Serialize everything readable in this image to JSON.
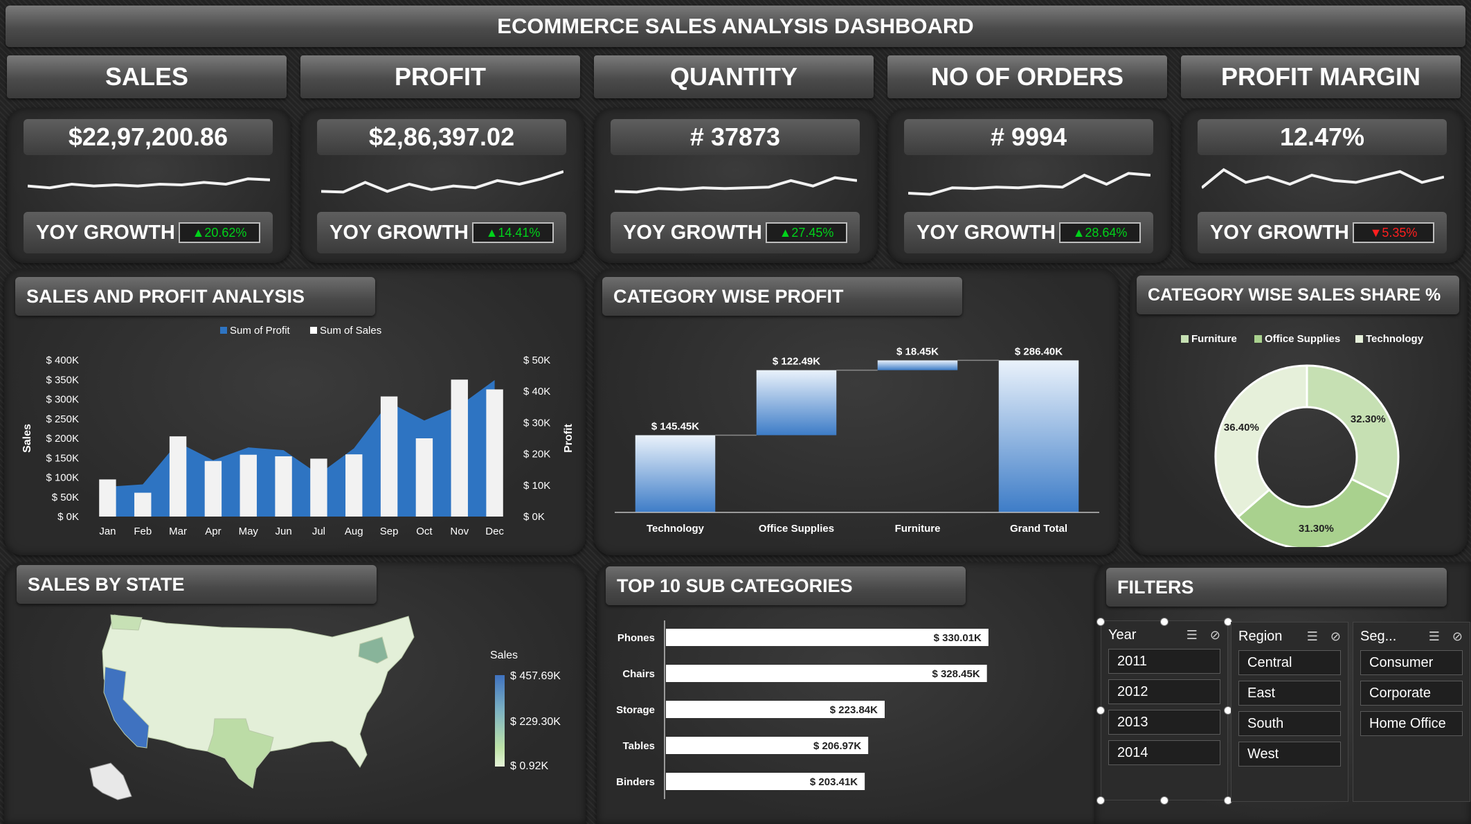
{
  "title": "ECOMMERCE SALES ANALYSIS DASHBOARD",
  "kpis": [
    {
      "label": "SALES",
      "value": "$22,97,200.86",
      "yoy_label": "YOY GROWTH",
      "growth": "▲20.62%",
      "direction": "up",
      "trend": [
        0.55,
        0.6,
        0.5,
        0.55,
        0.52,
        0.55,
        0.5,
        0.52,
        0.45,
        0.5,
        0.35,
        0.38
      ]
    },
    {
      "label": "PROFIT",
      "value": "$2,86,397.02",
      "yoy_label": "YOY GROWTH",
      "growth": "▲14.41%",
      "direction": "up",
      "trend": [
        0.7,
        0.72,
        0.45,
        0.7,
        0.5,
        0.65,
        0.55,
        0.6,
        0.4,
        0.5,
        0.35,
        0.15
      ]
    },
    {
      "label": "QUANTITY",
      "value": "# 37873",
      "yoy_label": "YOY GROWTH",
      "growth": "▲27.45%",
      "direction": "up",
      "trend": [
        0.7,
        0.72,
        0.62,
        0.65,
        0.6,
        0.62,
        0.6,
        0.58,
        0.4,
        0.55,
        0.32,
        0.4
      ]
    },
    {
      "label": "NO OF ORDERS",
      "value": "# 9994",
      "yoy_label": "YOY GROWTH",
      "growth": "▲28.64%",
      "direction": "up",
      "trend": [
        0.75,
        0.78,
        0.6,
        0.62,
        0.58,
        0.6,
        0.55,
        0.58,
        0.25,
        0.5,
        0.2,
        0.25
      ]
    },
    {
      "label": "PROFIT MARGIN",
      "value": "12.47%",
      "yoy_label": "YOY GROWTH",
      "growth": "▼5.35%",
      "direction": "down",
      "trend": [
        0.6,
        0.1,
        0.45,
        0.3,
        0.5,
        0.25,
        0.4,
        0.45,
        0.3,
        0.15,
        0.45,
        0.3
      ]
    }
  ],
  "sections": {
    "sales_profit": "SALES AND PROFIT ANALYSIS",
    "category_profit": "CATEGORY WISE PROFIT",
    "category_share": "CATEGORY WISE SALES SHARE %",
    "sales_by_state": "SALES BY STATE",
    "top10": "TOP 10 SUB CATEGORIES",
    "filters": "FILTERS"
  },
  "colors": {
    "blue": "#2e74c2",
    "white_bar": "#f2f2f2",
    "donut_light": "#e6f0da",
    "donut_mid": "#c6e0b3",
    "donut_dark": "#a9d18e"
  },
  "chart_data": [
    {
      "type": "bar",
      "title": "SALES AND PROFIT ANALYSIS",
      "categories": [
        "Jan",
        "Feb",
        "Mar",
        "Apr",
        "May",
        "Jun",
        "Jul",
        "Aug",
        "Sep",
        "Oct",
        "Nov",
        "Dec"
      ],
      "series": [
        {
          "name": "Sum of Profit",
          "type": "area",
          "axis": "right",
          "values": [
            9500,
            10300,
            23700,
            18000,
            22100,
            21200,
            13500,
            21800,
            36500,
            30700,
            35400,
            43600
          ]
        },
        {
          "name": "Sum of Sales",
          "type": "bar",
          "axis": "left",
          "values": [
            94900,
            60900,
            205000,
            142000,
            158000,
            154000,
            148000,
            159000,
            307000,
            200000,
            350000,
            325000
          ]
        }
      ],
      "ylabel": "Sales",
      "y2label": "Profit",
      "yticks": [
        "$ 0K",
        "$ 50K",
        "$ 100K",
        "$ 150K",
        "$ 200K",
        "$ 250K",
        "$ 300K",
        "$ 350K",
        "$ 400K"
      ],
      "y2ticks": [
        "$ 0K",
        "$ 10K",
        "$ 20K",
        "$ 30K",
        "$ 40K",
        "$ 50K"
      ],
      "ylim": [
        0,
        400000
      ],
      "y2lim": [
        0,
        50000
      ],
      "legend": "top"
    },
    {
      "type": "bar",
      "subtype": "waterfall",
      "title": "CATEGORY WISE PROFIT",
      "categories": [
        "Technology",
        "Office Supplies",
        "Furniture",
        "Grand Total"
      ],
      "values": [
        145.45,
        122.49,
        18.45,
        286.4
      ],
      "labels": [
        "$ 145.45K",
        "$ 122.49K",
        "$ 18.45K",
        "$ 286.40K"
      ],
      "ylim": [
        0,
        300
      ]
    },
    {
      "type": "pie",
      "subtype": "donut",
      "title": "CATEGORY WISE SALES SHARE %",
      "categories": [
        "Furniture",
        "Office Supplies",
        "Technology"
      ],
      "values": [
        32.3,
        31.3,
        36.4
      ],
      "labels": [
        "32.30%",
        "31.30%",
        "36.40%"
      ],
      "legend": "top"
    },
    {
      "type": "bar",
      "subtype": "horizontal",
      "title": "TOP 10 SUB CATEGORIES",
      "categories": [
        "Phones",
        "Chairs",
        "Storage",
        "Tables",
        "Binders"
      ],
      "values": [
        330.01,
        328.45,
        223.84,
        206.97,
        203.41
      ],
      "labels": [
        "$ 330.01K",
        "$ 328.45K",
        "$ 223.84K",
        "$ 206.97K",
        "$ 203.41K"
      ]
    }
  ],
  "map": {
    "legend_title": "Sales",
    "legend_max": "$ 457.69K",
    "legend_mid": "$ 229.30K",
    "legend_min": "$ 0.92K"
  },
  "filters": {
    "year": {
      "title": "Year",
      "items": [
        "2011",
        "2012",
        "2013",
        "2014"
      ]
    },
    "region": {
      "title": "Region",
      "items": [
        "Central",
        "East",
        "South",
        "West"
      ]
    },
    "segment": {
      "title": "Seg...",
      "items": [
        "Consumer",
        "Corporate",
        "Home Office"
      ]
    }
  }
}
